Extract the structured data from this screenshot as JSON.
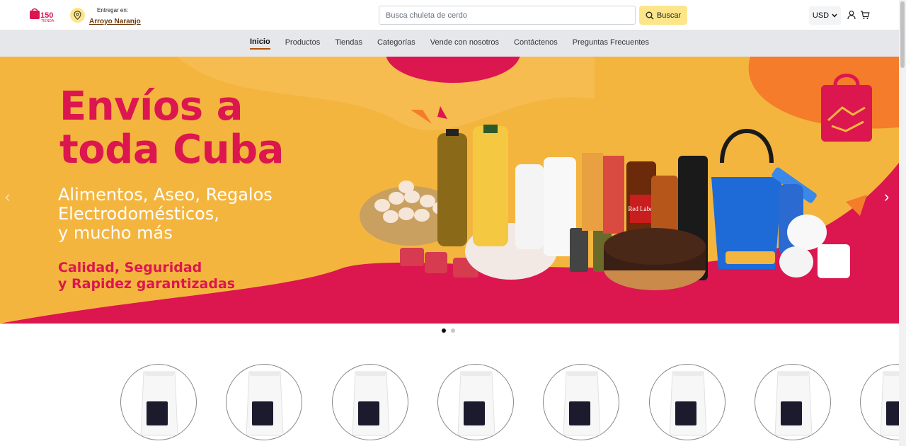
{
  "header": {
    "logo_alt": "150 Tienda",
    "deliver_label": "Entregar en:",
    "deliver_place": "Arroyo Naranjo",
    "search_placeholder": "Busca chuleta de cerdo",
    "search_button": "Buscar",
    "currency": "USD",
    "icons": [
      "map-pin-icon",
      "search-icon",
      "chevron-down-icon",
      "user-icon",
      "cart-icon"
    ]
  },
  "nav": {
    "items": [
      {
        "label": "Inicio",
        "active": true
      },
      {
        "label": "Productos"
      },
      {
        "label": "Tiendas"
      },
      {
        "label": "Categorías"
      },
      {
        "label": "Vende con nosotros"
      },
      {
        "label": "Contáctenos"
      },
      {
        "label": "Preguntas Frecuentes"
      }
    ]
  },
  "banner": {
    "headline_line1": "Envíos a",
    "headline_line2": "toda Cuba",
    "sub_line1": "Alimentos, Aseo, Regalos",
    "sub_line2": "Electrodomésticos,",
    "sub_line3": "y mucho más",
    "tag_line1": "Calidad, Seguridad",
    "tag_line2": "y Rapidez garantizadas",
    "product_label": "Red Label",
    "prev_arrow": "‹",
    "next_arrow": "›",
    "colors": {
      "background": "#f4b53f",
      "accent": "#dc164f"
    }
  },
  "carousel": {
    "slides": 2,
    "active_slide": 1
  },
  "categories": {
    "count_visible": 8
  }
}
